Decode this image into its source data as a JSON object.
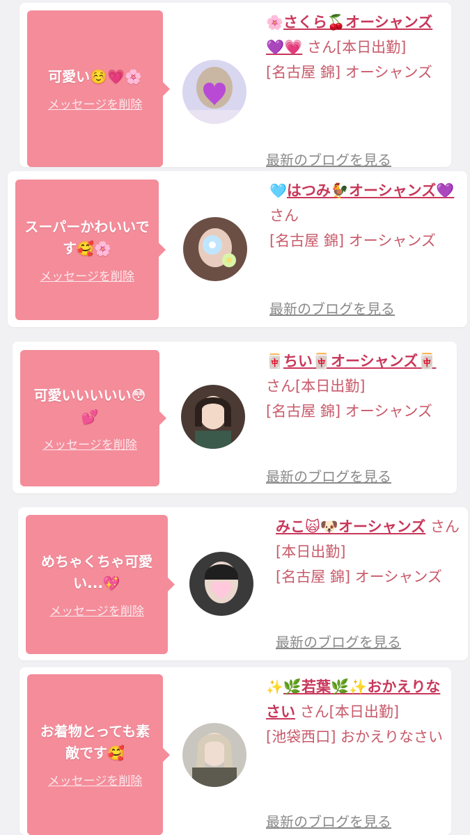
{
  "cards": [
    {
      "message": "可愛い☺️💗🌸",
      "delete_label": "メッセージを削除",
      "name_prefix_icon": "🌸",
      "name_main": "さくら🍒オーシャンズ💜💗",
      "suffix": "さん[本日出勤]",
      "shop": "[名古屋 錦] オーシャンズ",
      "blog_label": "最新のブログを見る",
      "avatar": {
        "bg": "#d9d6f0",
        "accent": "#b84ad6",
        "icon": "heart-sticker-icon"
      }
    },
    {
      "message": "スーパーかわいいです🥰🌸",
      "delete_label": "メッセージを削除",
      "name_prefix_icon": "🩵",
      "name_main": "はつみ🐓オーシャンズ💜",
      "suffix": "さん",
      "shop": "[名古屋 錦] オーシャンズ",
      "blog_label": "最新のブログを見る",
      "avatar": {
        "bg": "#6b4f45",
        "accent": "#bfe6ff",
        "icon": "flower-sticker-icon"
      }
    },
    {
      "message": "可愛いいいいい😳💕",
      "delete_label": "メッセージを削除",
      "name_prefix_icon": "🀄",
      "name_main": "ちい🀄オーシャンズ🀄",
      "suffix": "さん[本日出勤]",
      "shop": "[名古屋 錦] オーシャンズ",
      "blog_label": "最新のブログを見る",
      "avatar": {
        "bg": "#4a3a33",
        "accent": "#f2d9c8",
        "icon": "girl-photo-icon"
      }
    },
    {
      "message": "めちゃくちゃ可愛い...💖",
      "delete_label": "メッセージを削除",
      "name_prefix_icon": "",
      "name_main": "みこ🙀🐶オーシャンズ",
      "suffix": "さん[本日出勤]",
      "shop": "[名古屋 錦] オーシャンズ",
      "blog_label": "最新のブログを見る",
      "avatar": {
        "bg": "#3a3a3a",
        "accent": "#ffc8dc",
        "icon": "heart-sticker-icon"
      }
    },
    {
      "message": "お着物とっても素敵です🥰",
      "delete_label": "メッセージを削除",
      "name_prefix_icon": "✨",
      "name_main": "🌿若葉🌿✨おかえりなさい",
      "suffix": "さん[本日出勤]",
      "shop": "[池袋西口] おかえりなさい",
      "blog_label": "最新のブログを見る",
      "avatar": {
        "bg": "#c9c6bf",
        "accent": "#5d5a4f",
        "icon": "girl-photo-icon"
      }
    }
  ],
  "colors": {
    "accent": "#f48c9a",
    "name": "#c8375a",
    "text": "#c85a6a",
    "link_gray": "#8a8a8a"
  }
}
